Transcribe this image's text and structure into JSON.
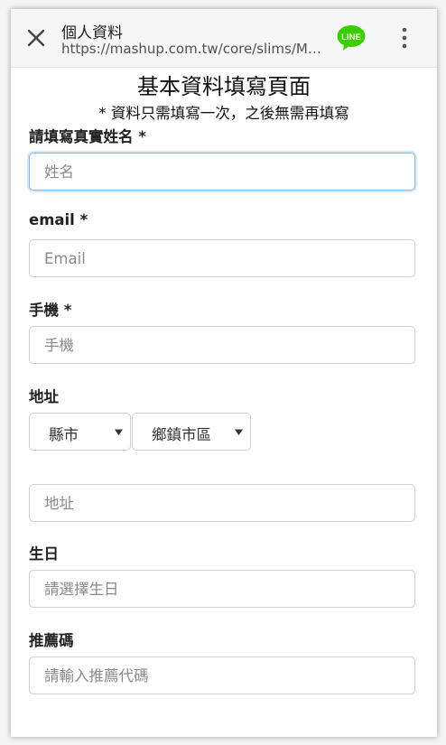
{
  "appbar": {
    "title": "個人資料",
    "url": "https://mashup.com.tw/core/slims/Ma..."
  },
  "page": {
    "title": "基本資料填寫頁面",
    "subtitle": "* 資料只需填寫一次，之後無需再填寫"
  },
  "form": {
    "name": {
      "label": "請填寫真實姓名 *",
      "placeholder": "姓名",
      "value": ""
    },
    "email": {
      "label": "email *",
      "placeholder": "Email",
      "value": ""
    },
    "phone": {
      "label": "手機 *",
      "placeholder": "手機",
      "value": ""
    },
    "address": {
      "label": "地址",
      "city_selected": "縣市",
      "district_selected": "鄉鎮市區",
      "placeholder": "地址",
      "value": ""
    },
    "birthday": {
      "label": "生日",
      "placeholder": "請選擇生日",
      "value": ""
    },
    "referral": {
      "label": "推薦碼",
      "placeholder": "請輸入推薦代碼",
      "value": ""
    }
  },
  "colors": {
    "line_green": "#3ACE01",
    "focus_border": "#86b7e2"
  },
  "icons": {
    "close": "close-icon",
    "line": "line-app-icon",
    "more": "more-vertical-icon",
    "caret": "caret-down-icon"
  }
}
